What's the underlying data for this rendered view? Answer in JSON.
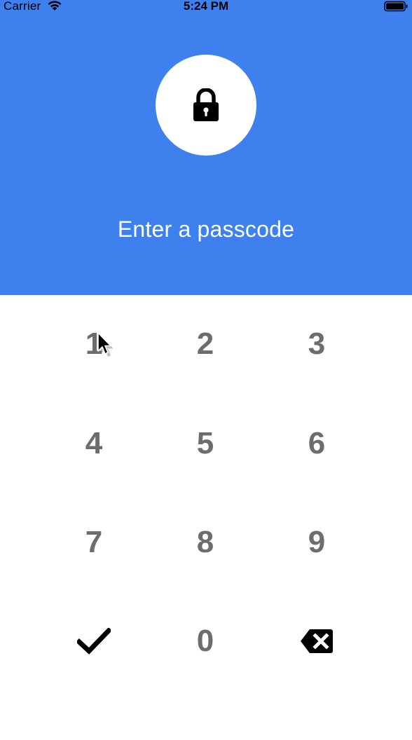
{
  "status_bar": {
    "carrier": "Carrier",
    "time": "5:24 PM",
    "icons": [
      "wifi-icon",
      "battery-icon"
    ]
  },
  "header": {
    "background_color": "#3f80ef",
    "icon": "lock-icon",
    "prompt": "Enter a passcode"
  },
  "keypad": {
    "text_color": "#6d6d6d",
    "keys": {
      "k1": "1",
      "k2": "2",
      "k3": "3",
      "k4": "4",
      "k5": "5",
      "k6": "6",
      "k7": "7",
      "k8": "8",
      "k9": "9",
      "k0": "0"
    },
    "confirm_icon": "checkmark-icon",
    "delete_icon": "backspace-icon"
  }
}
